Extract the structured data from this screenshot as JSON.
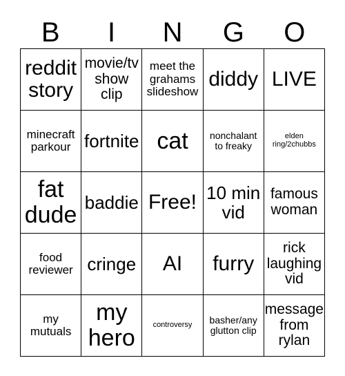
{
  "card": {
    "headers": [
      "B",
      "I",
      "N",
      "G",
      "O"
    ],
    "rows": [
      [
        {
          "text": "reddit story",
          "size": "fs-xl"
        },
        {
          "text": "movie/tv show clip",
          "size": "fs-md"
        },
        {
          "text": "meet the grahams slideshow",
          "size": "fs-sm"
        },
        {
          "text": "diddy",
          "size": "fs-xl"
        },
        {
          "text": "LIVE",
          "size": "fs-xl"
        }
      ],
      [
        {
          "text": "minecraft parkour",
          "size": "fs-sm"
        },
        {
          "text": "fortnite",
          "size": "fs-lg"
        },
        {
          "text": "cat",
          "size": "fs-xxl"
        },
        {
          "text": "nonchalant to freaky",
          "size": "fs-xs"
        },
        {
          "text": "elden ring/2chubbs",
          "size": "fs-xxs"
        }
      ],
      [
        {
          "text": "fat dude",
          "size": "fs-xxl"
        },
        {
          "text": "baddie",
          "size": "fs-lg"
        },
        {
          "text": "Free!",
          "size": "fs-xl"
        },
        {
          "text": "10 min vid",
          "size": "fs-lg"
        },
        {
          "text": "famous woman",
          "size": "fs-md"
        }
      ],
      [
        {
          "text": "food reviewer",
          "size": "fs-sm"
        },
        {
          "text": "cringe",
          "size": "fs-lg"
        },
        {
          "text": "AI",
          "size": "fs-xl"
        },
        {
          "text": "furry",
          "size": "fs-xl"
        },
        {
          "text": "rick laughing vid",
          "size": "fs-md"
        }
      ],
      [
        {
          "text": "my mutuals",
          "size": "fs-sm"
        },
        {
          "text": "my hero",
          "size": "fs-xxl"
        },
        {
          "text": "controversy",
          "size": "fs-xxs"
        },
        {
          "text": "basher/any glutton clip",
          "size": "fs-xs"
        },
        {
          "text": "message from rylan",
          "size": "fs-md"
        }
      ]
    ]
  },
  "colors": {
    "background": "#ffffff",
    "text": "#000000",
    "grid_line": "#000000"
  }
}
